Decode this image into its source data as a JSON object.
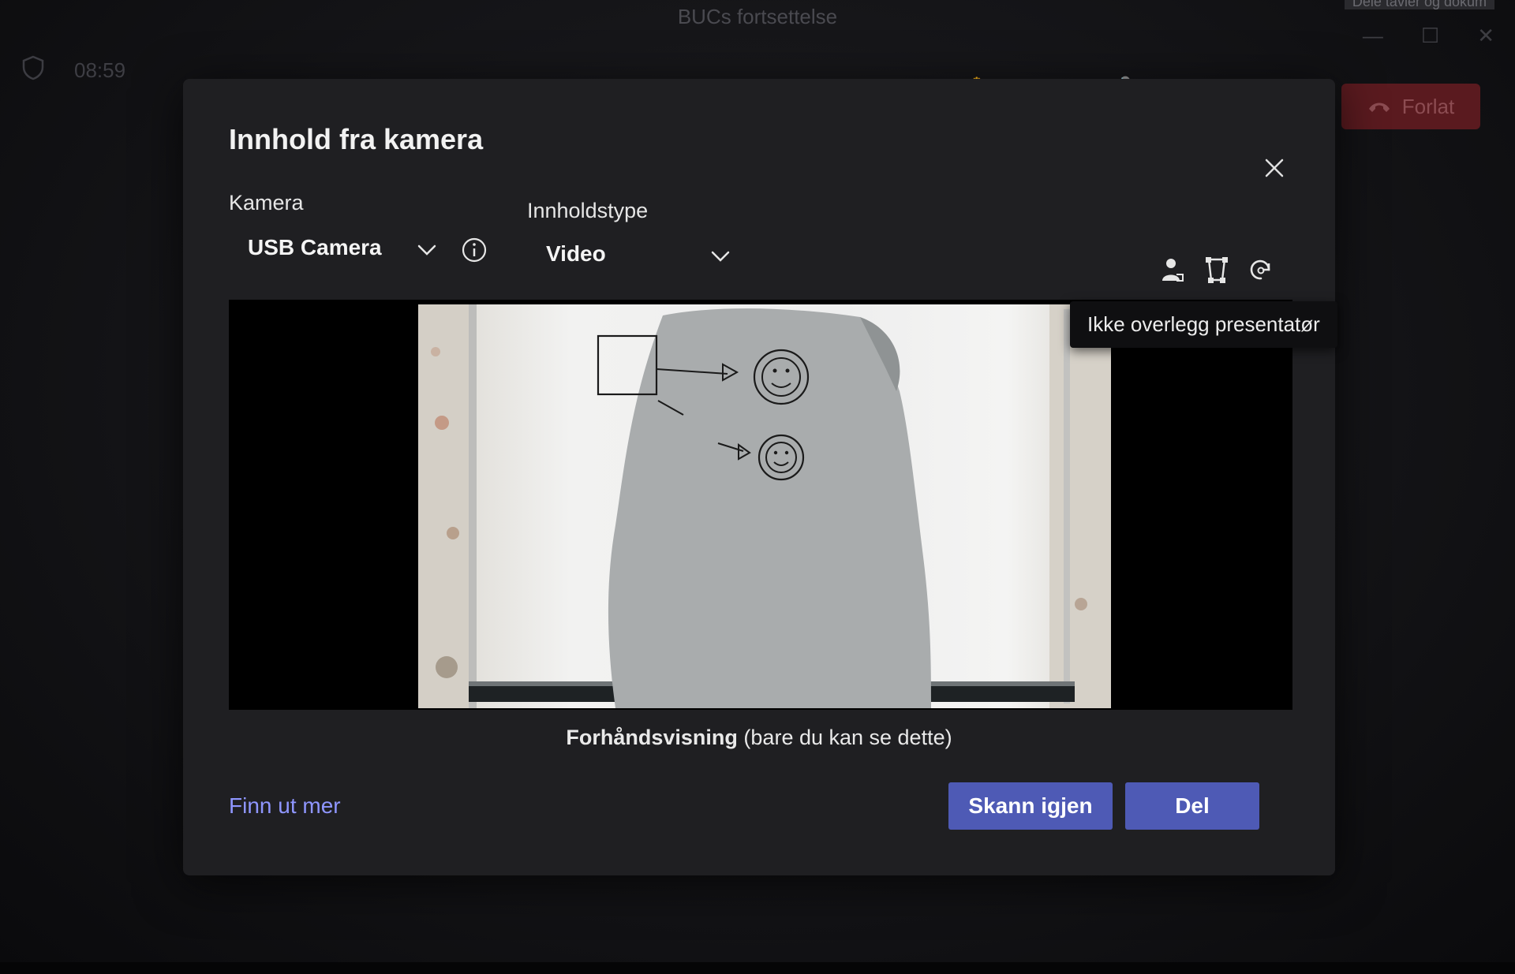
{
  "background": {
    "window_title": "BUCs fortsettelse",
    "time": "08:59",
    "leave_label": "Forlat",
    "tab_text": "Dele tavler og dokum"
  },
  "dialog": {
    "title": "Innhold fra kamera",
    "camera": {
      "label": "Kamera",
      "value": "USB Camera"
    },
    "content_type": {
      "label": "Innholdstype",
      "value": "Video"
    },
    "tooltip": "Ikke overlegg presentatør",
    "preview": {
      "caption_bold": "Forhåndsvisning",
      "caption_rest": " (bare du kan se dette)"
    },
    "learn_more": "Finn ut mer",
    "rescan_label": "Skann igjen",
    "share_label": "Del"
  },
  "colors": {
    "dialog_bg": "#1f1f22",
    "primary_button": "#4e5ab5",
    "link": "#8f96ff"
  },
  "icons": [
    "shield-icon",
    "close-icon",
    "chevron-down-icon",
    "info-icon",
    "presenter-overlay-icon",
    "frame-icon",
    "rotate-icon",
    "phone-icon"
  ]
}
